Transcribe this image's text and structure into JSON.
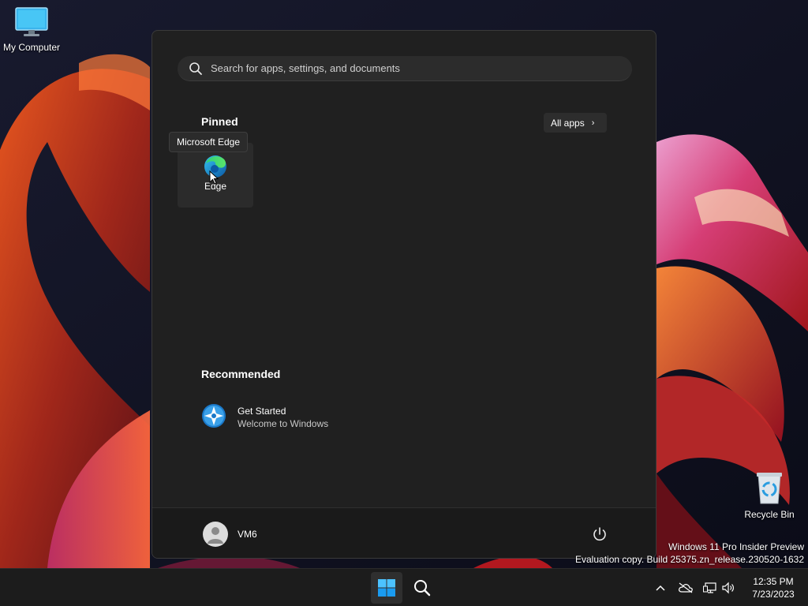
{
  "desktop": {
    "icons": [
      {
        "label": "My Computer"
      },
      {
        "label": "Recycle Bin"
      }
    ],
    "watermark": {
      "line1": "Windows 11 Pro Insider Preview",
      "line2": "Evaluation copy. Build 25375.zn_release.230520-1632"
    }
  },
  "start_menu": {
    "search": {
      "placeholder": "Search for apps, settings, and documents"
    },
    "pinned": {
      "title": "Pinned",
      "all_apps_label": "All apps",
      "apps": [
        {
          "label": "Edge",
          "tooltip": "Microsoft Edge",
          "icon": "edge-icon"
        }
      ]
    },
    "recommended": {
      "title": "Recommended",
      "items": [
        {
          "name": "Get Started",
          "subtitle": "Welcome to Windows",
          "icon": "get-started-icon"
        }
      ]
    },
    "user": {
      "name": "VM6"
    }
  },
  "taskbar": {
    "clock": {
      "time": "12:35 PM",
      "date": "7/23/2023"
    }
  },
  "colors": {
    "accent": "#0078d4",
    "menu_bg": "#202020",
    "taskbar_bg": "#1c1c1c"
  }
}
